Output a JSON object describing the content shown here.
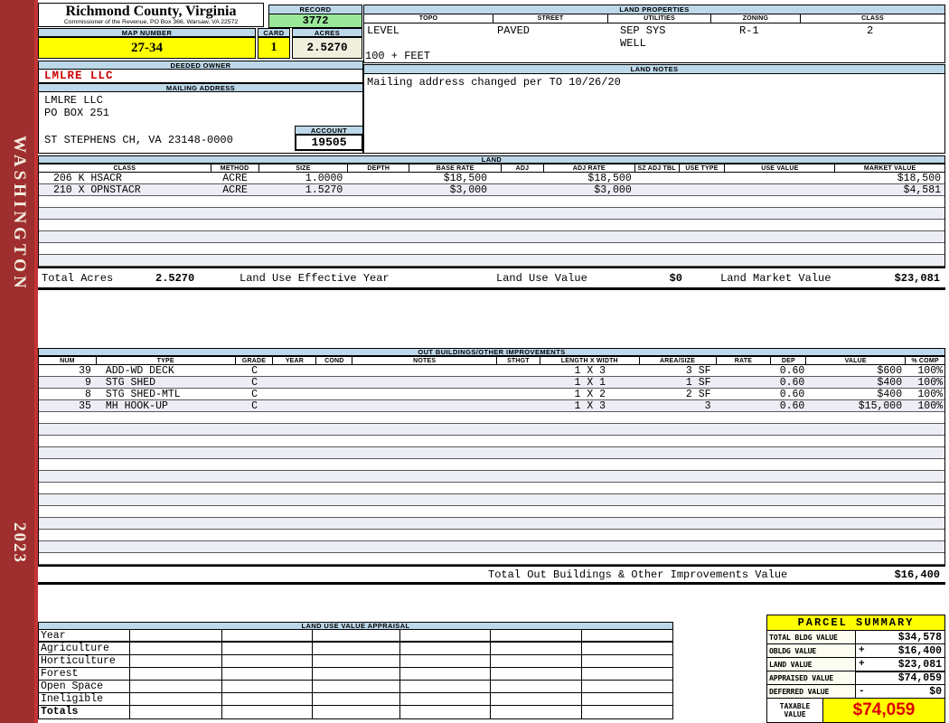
{
  "sidebar": {
    "county": "WASHINGTON",
    "year": "2023"
  },
  "colors": {
    "sidebar_red": "#9F2E2E",
    "header_blue": "#BCD8E9",
    "record_green": "#9BE89B",
    "highlight_yellow": "#FFFF00",
    "acres_cream": "#F0EFDD",
    "owner_red": "#CC0000",
    "taxable_red": "#DD0000",
    "alt_row": "#EDEDF5"
  },
  "header": {
    "county_title": "Richmond County, Virginia",
    "county_subtitle": "Commissioner of the Revenue, PO Box 366, Warsaw, VA 22572",
    "record_label": "RECORD",
    "record_value": "3772",
    "map_number_label": "MAP NUMBER",
    "map_number_value": "27-34",
    "card_label": "CARD",
    "card_value": "1",
    "acres_label": "ACRES",
    "acres_value": "2.5270"
  },
  "owner": {
    "deeded_owner_label": "DEEDED OWNER",
    "deeded_owner": "LMLRE LLC",
    "mailing_address_label": "MAILING ADDRESS",
    "address_line1": "LMLRE LLC",
    "address_line2": "PO BOX 251",
    "address_line3": "ST STEPHENS CH, VA 23148-0000",
    "account_label": "ACCOUNT",
    "account_value": "19505"
  },
  "land_properties": {
    "title": "LAND PROPERTIES",
    "columns": [
      "TOPO",
      "STREET",
      "UTILITIES",
      "ZONING",
      "CLASS"
    ],
    "topo": "LEVEL",
    "street": "PAVED",
    "utilities1": "SEP SYS",
    "utilities2": "WELL",
    "zoning": "R-1",
    "class": "2",
    "topo2": "100 + FEET"
  },
  "land_notes": {
    "title": "LAND NOTES",
    "note": "Mailing address changed per TO 10/26/20"
  },
  "land": {
    "title": "LAND",
    "columns": [
      "CLASS",
      "METHOD",
      "SIZE",
      "DEPTH",
      "BASE RATE",
      "ADJ",
      "ADJ RATE",
      "SZ ADJ TBL",
      "USE TYPE",
      "USE VALUE",
      "MARKET VALUE"
    ],
    "rows": [
      {
        "class": "206 K HSACR",
        "method": "ACRE",
        "size": "1.0000",
        "depth": "",
        "base_rate": "$18,500",
        "adj": "",
        "adj_rate": "$18,500",
        "sz_adj_tbl": "",
        "use_type": "",
        "use_value": "",
        "market_value": "$18,500"
      },
      {
        "class": "210 X OPNSTACR",
        "method": "ACRE",
        "size": "1.5270",
        "depth": "",
        "base_rate": "$3,000",
        "adj": "",
        "adj_rate": "$3,000",
        "sz_adj_tbl": "",
        "use_type": "",
        "use_value": "",
        "market_value": "$4,581"
      }
    ],
    "totals": {
      "total_acres_label": "Total Acres",
      "total_acres": "2.5270",
      "effective_year_label": "Land Use Effective Year",
      "use_value_label": "Land Use Value",
      "use_value": "$0",
      "market_value_label": "Land Market Value",
      "market_value": "$23,081"
    }
  },
  "out_buildings": {
    "title": "OUT BUILDINGS/OTHER IMPROVEMENTS",
    "columns": [
      "NUM",
      "TYPE",
      "GRADE",
      "YEAR",
      "COND",
      "NOTES",
      "STHGT",
      "LENGTH X WIDTH",
      "AREA/SIZE",
      "RATE",
      "DEP",
      "VALUE",
      "% COMP"
    ],
    "rows": [
      {
        "num": "39",
        "type": "ADD-WD DECK",
        "grade": "C",
        "year": "",
        "cond": "",
        "notes": "",
        "sthgt": "",
        "lxw": "1 X 3",
        "area": "3 SF",
        "rate": "",
        "dep": "0.60",
        "value": "$600",
        "comp": "100%"
      },
      {
        "num": "9",
        "type": "STG SHED",
        "grade": "C",
        "year": "",
        "cond": "",
        "notes": "",
        "sthgt": "",
        "lxw": "1 X 1",
        "area": "1 SF",
        "rate": "",
        "dep": "0.60",
        "value": "$400",
        "comp": "100%"
      },
      {
        "num": "8",
        "type": "STG SHED-MTL",
        "grade": "C",
        "year": "",
        "cond": "",
        "notes": "",
        "sthgt": "",
        "lxw": "1 X 2",
        "area": "2 SF",
        "rate": "",
        "dep": "0.60",
        "value": "$400",
        "comp": "100%"
      },
      {
        "num": "35",
        "type": "MH HOOK-UP",
        "grade": "C",
        "year": "",
        "cond": "",
        "notes": "",
        "sthgt": "",
        "lxw": "1 X 3",
        "area": "3",
        "rate": "",
        "dep": "0.60",
        "value": "$15,000",
        "comp": "100%"
      }
    ],
    "total_label": "Total Out Buildings & Other Improvements Value",
    "total_value": "$16,400"
  },
  "land_use_appraisal": {
    "title": "LAND USE VALUE APPRAISAL",
    "row_labels": [
      "Year",
      "Agriculture",
      "Horticulture",
      "Forest",
      "Open Space",
      "Ineligible",
      "Totals"
    ]
  },
  "parcel_summary": {
    "title": "PARCEL SUMMARY",
    "rows": [
      {
        "label": "TOTAL BLDG VALUE",
        "op": "",
        "value": "$34,578"
      },
      {
        "label": "OBLDG VALUE",
        "op": "+",
        "value": "$16,400"
      },
      {
        "label": "LAND VALUE",
        "op": "+",
        "value": "$23,081"
      },
      {
        "label": "APPRAISED VALUE",
        "op": "",
        "value": "$74,059"
      },
      {
        "label": "DEFERRED VALUE",
        "op": "-",
        "value": "$0"
      }
    ],
    "taxable_label1": "TAXABLE",
    "taxable_label2": "VALUE",
    "taxable_value": "$74,059"
  }
}
